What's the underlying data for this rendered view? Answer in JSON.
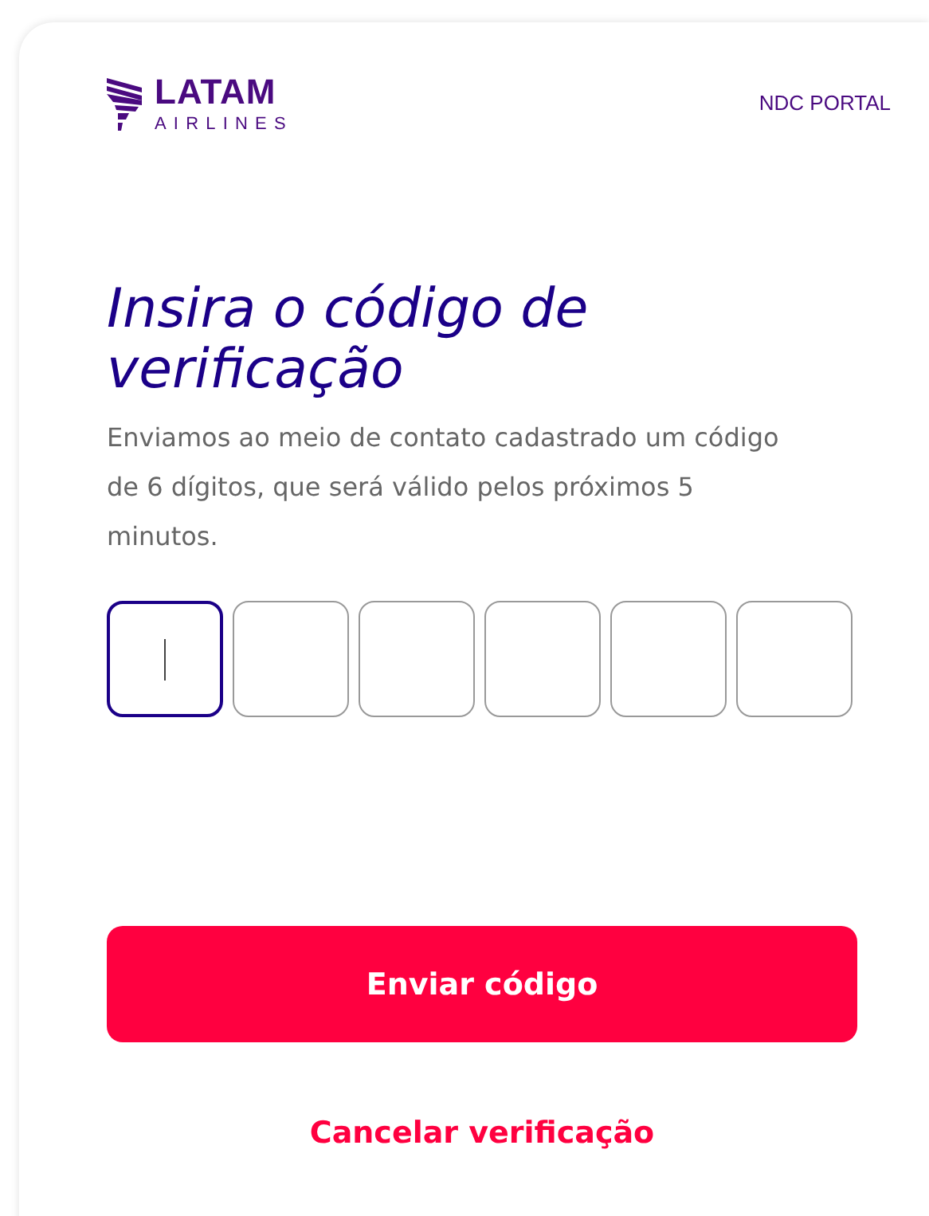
{
  "header": {
    "logo": {
      "name": "LATAM",
      "subtitle": "AIRLINES"
    },
    "portal": "NDC PORTAL"
  },
  "title": "Insira o código de verificação",
  "description": "Enviamos ao meio de contato cadastrado um código de 6 dígitos, que será válido pelos próximos 5 minutos.",
  "code_boxes": [
    {
      "selected": true
    },
    {
      "selected": false
    },
    {
      "selected": false
    },
    {
      "selected": false
    },
    {
      "selected": false
    },
    {
      "selected": false
    }
  ],
  "buttons": {
    "submit": "Enviar código",
    "cancel": "Cancelar verificação"
  }
}
